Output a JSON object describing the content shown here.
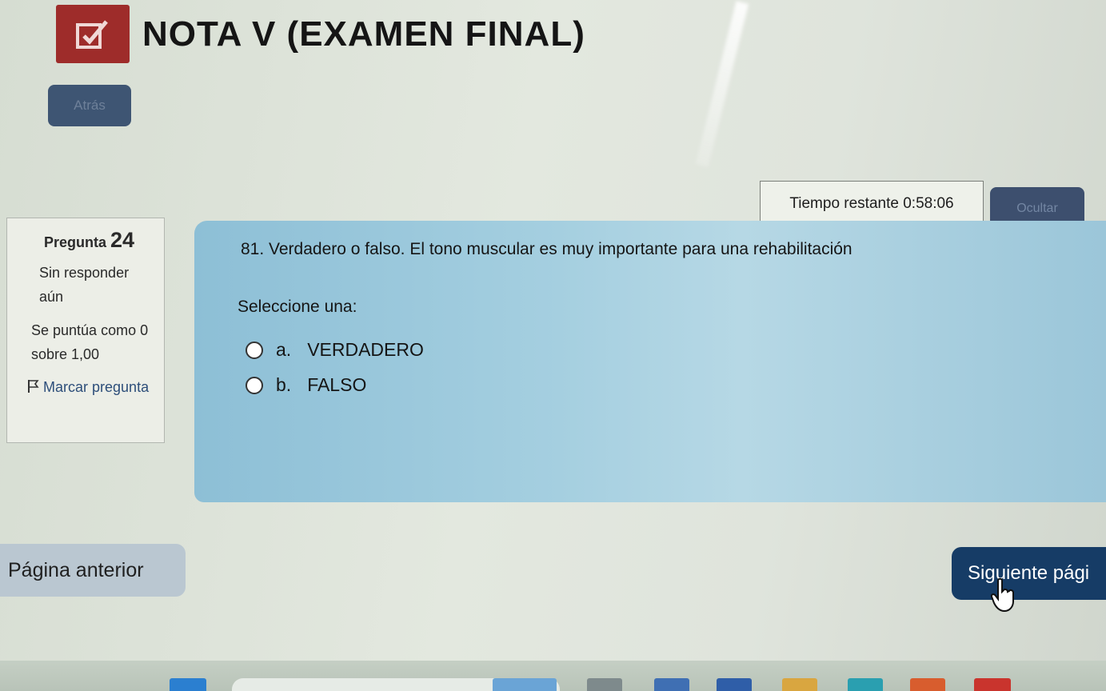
{
  "header": {
    "logo_icon": "checkbox-edit-icon",
    "title": "NOTA V (EXAMEN FINAL)",
    "back_label": "Atrás"
  },
  "timer": {
    "label": "Tiempo restante",
    "value": "0:58:06",
    "hide_label": "Ocultar"
  },
  "question_info": {
    "label": "Pregunta",
    "number": "24",
    "state": "Sin responder aún",
    "mark": "Se puntúa como 0 sobre 1,00",
    "flag_icon": "flag-icon",
    "flag_label": "Marcar pregunta"
  },
  "question": {
    "text": "81. Verdadero o falso. El tono muscular es muy importante para una rehabilitación",
    "prompt": "Seleccione una:",
    "options": [
      {
        "letter": "a.",
        "label": "VERDADERO"
      },
      {
        "letter": "b.",
        "label": "FALSO"
      }
    ]
  },
  "navigation": {
    "previous_label": "Página anterior",
    "next_label": "Siguiente pági"
  },
  "colors": {
    "logo_red": "#9e2c2a",
    "primary_blue": "#163c66",
    "question_bg": "#a5cfe0"
  }
}
